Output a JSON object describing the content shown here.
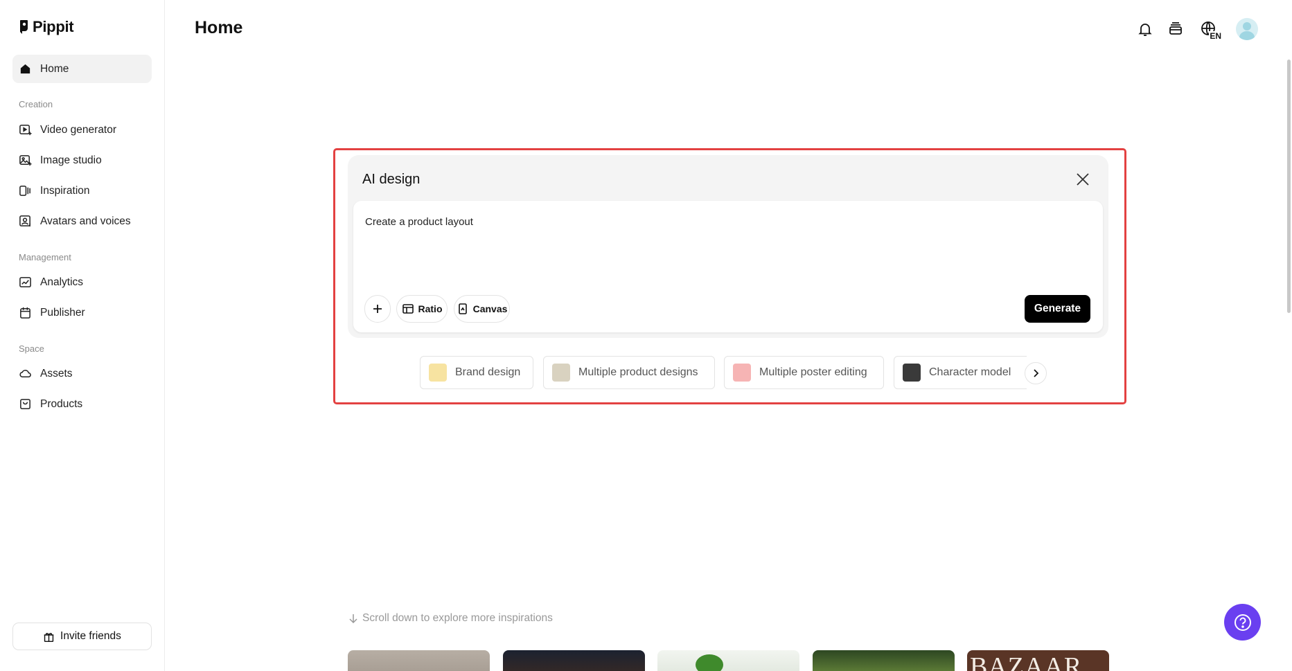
{
  "app": {
    "name": "Pippit"
  },
  "sidebar": {
    "home_label": "Home",
    "sections": [
      {
        "label": "Creation",
        "items": [
          {
            "label": "Video generator",
            "icon": "video-generator-icon"
          },
          {
            "label": "Image studio",
            "icon": "image-studio-icon"
          },
          {
            "label": "Inspiration",
            "icon": "inspiration-icon"
          },
          {
            "label": "Avatars and voices",
            "icon": "avatar-voice-icon"
          }
        ]
      },
      {
        "label": "Management",
        "items": [
          {
            "label": "Analytics",
            "icon": "analytics-icon"
          },
          {
            "label": "Publisher",
            "icon": "calendar-icon"
          }
        ]
      },
      {
        "label": "Space",
        "items": [
          {
            "label": "Assets",
            "icon": "cloud-icon"
          },
          {
            "label": "Products",
            "icon": "bag-icon"
          }
        ]
      }
    ],
    "invite_label": "Invite friends"
  },
  "header": {
    "title": "Home",
    "language": "EN"
  },
  "ai_design": {
    "title": "AI design",
    "prompt_value": "Create a product layout",
    "ratio_label": "Ratio",
    "canvas_label": "Canvas",
    "generate_label": "Generate",
    "chips": [
      {
        "label": "Brand design",
        "thumb_color": "#f7e3a1"
      },
      {
        "label": "Multiple product designs",
        "thumb_color": "#d9d2c0"
      },
      {
        "label": "Multiple poster editing",
        "thumb_color": "#f6b4b4"
      },
      {
        "label": "Character model",
        "thumb_color": "#3a3a3a"
      }
    ]
  },
  "explore": {
    "hint": "Scroll down to explore more inspirations",
    "cards": [
      {
        "color": "#b7aea4"
      },
      {
        "color": "#1c2230"
      },
      {
        "color": "#e8ede6"
      },
      {
        "color": "#3f5a2e"
      },
      {
        "color": "#5a3526",
        "text": "BAZAAR"
      }
    ]
  },
  "colors": {
    "accent": "#6a3ff0",
    "highlight": "#e34141",
    "primary_button": "#000000"
  }
}
